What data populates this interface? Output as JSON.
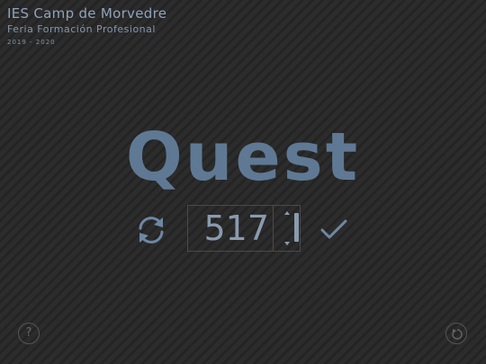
{
  "header": {
    "school": "IES Camp de Morvedre",
    "fair": "Feria Formación Profesional",
    "years": "2019 - 2020"
  },
  "game": {
    "title": "Quest",
    "number_value": "517"
  },
  "buttons": {
    "help_label": "?"
  },
  "colors": {
    "accent": "#5f7893",
    "text": "#8a9bb0",
    "background": "#2a2a2a"
  },
  "icons": {
    "refresh": "refresh-icon",
    "check": "check-icon",
    "reset": "reset-icon",
    "help": "help-icon"
  }
}
